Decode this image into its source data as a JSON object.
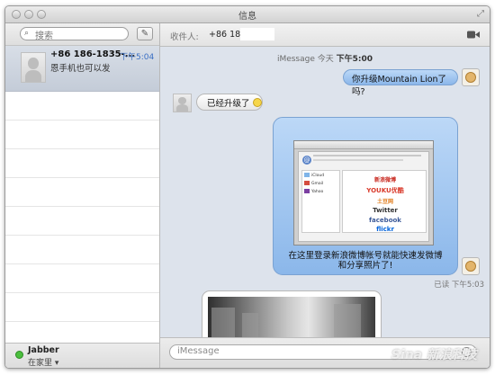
{
  "window": {
    "title": "信息"
  },
  "sidebar": {
    "search_placeholder": "搜索",
    "conversations": [
      {
        "name": "+86 186-1835-...",
        "time": "下午5:04",
        "preview": "恩手机也可以发"
      }
    ],
    "status": {
      "account": "Jabber",
      "location": "在家里 ▾",
      "status_color": "#4bbf3e"
    }
  },
  "chat": {
    "to_label": "收件人:",
    "to_value": "+86 186-1",
    "stamp_service": "iMessage",
    "stamp_day": "今天",
    "stamp_time": "下午5:00",
    "messages": [
      {
        "from": "me",
        "text": "你升级Mountain Lion了吗?"
      },
      {
        "from": "them",
        "text": "已经升级了"
      },
      {
        "from": "me",
        "type": "image",
        "caption": "在这里登录新浪微博帐号就能快速发微博和分享照片了!"
      }
    ],
    "read_receipt": "已读 下午5:03",
    "input_placeholder": "iMessage",
    "bubble_me_color": "#9fc4ef",
    "bubble_them_color": "#ffffff"
  },
  "screenshot_services": {
    "accounts": [
      "iCloud",
      "Gmail",
      "Yahoo"
    ],
    "services": [
      "新浪微博",
      "YOUKU优酷",
      "土豆网",
      "Twitter",
      "facebook",
      "flickr"
    ]
  },
  "watermark": "Sina 新浪科技"
}
